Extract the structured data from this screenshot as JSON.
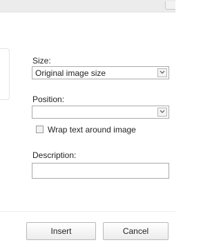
{
  "form": {
    "size_label": "Size:",
    "size_value": "Original image size",
    "position_label": "Position:",
    "position_value": "",
    "wrap_checkbox_label": "Wrap text around image",
    "wrap_checked": false,
    "description_label": "Description:",
    "description_value": ""
  },
  "footer": {
    "insert_label": "Insert",
    "cancel_label": "Cancel"
  },
  "icons": {
    "dropdown": "chevron-down-icon"
  }
}
